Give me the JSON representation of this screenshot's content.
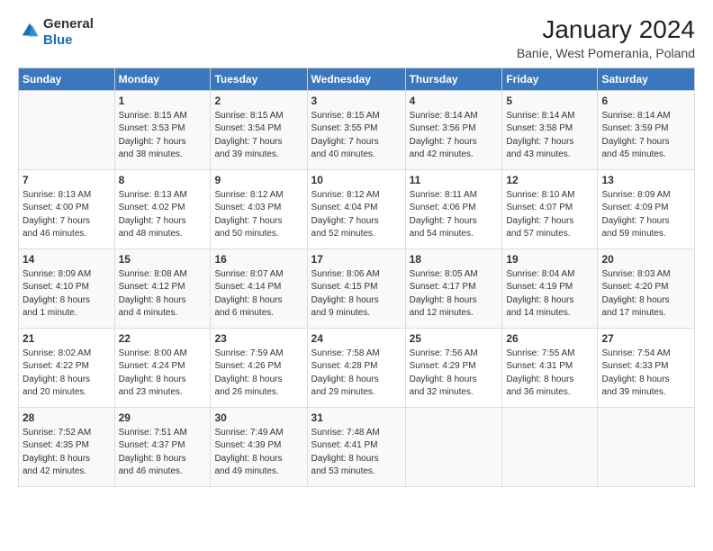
{
  "logo": {
    "general": "General",
    "blue": "Blue"
  },
  "title": "January 2024",
  "subtitle": "Banie, West Pomerania, Poland",
  "days_header": [
    "Sunday",
    "Monday",
    "Tuesday",
    "Wednesday",
    "Thursday",
    "Friday",
    "Saturday"
  ],
  "weeks": [
    [
      {
        "day": "",
        "info": ""
      },
      {
        "day": "1",
        "info": "Sunrise: 8:15 AM\nSunset: 3:53 PM\nDaylight: 7 hours\nand 38 minutes."
      },
      {
        "day": "2",
        "info": "Sunrise: 8:15 AM\nSunset: 3:54 PM\nDaylight: 7 hours\nand 39 minutes."
      },
      {
        "day": "3",
        "info": "Sunrise: 8:15 AM\nSunset: 3:55 PM\nDaylight: 7 hours\nand 40 minutes."
      },
      {
        "day": "4",
        "info": "Sunrise: 8:14 AM\nSunset: 3:56 PM\nDaylight: 7 hours\nand 42 minutes."
      },
      {
        "day": "5",
        "info": "Sunrise: 8:14 AM\nSunset: 3:58 PM\nDaylight: 7 hours\nand 43 minutes."
      },
      {
        "day": "6",
        "info": "Sunrise: 8:14 AM\nSunset: 3:59 PM\nDaylight: 7 hours\nand 45 minutes."
      }
    ],
    [
      {
        "day": "7",
        "info": "Sunrise: 8:13 AM\nSunset: 4:00 PM\nDaylight: 7 hours\nand 46 minutes."
      },
      {
        "day": "8",
        "info": "Sunrise: 8:13 AM\nSunset: 4:02 PM\nDaylight: 7 hours\nand 48 minutes."
      },
      {
        "day": "9",
        "info": "Sunrise: 8:12 AM\nSunset: 4:03 PM\nDaylight: 7 hours\nand 50 minutes."
      },
      {
        "day": "10",
        "info": "Sunrise: 8:12 AM\nSunset: 4:04 PM\nDaylight: 7 hours\nand 52 minutes."
      },
      {
        "day": "11",
        "info": "Sunrise: 8:11 AM\nSunset: 4:06 PM\nDaylight: 7 hours\nand 54 minutes."
      },
      {
        "day": "12",
        "info": "Sunrise: 8:10 AM\nSunset: 4:07 PM\nDaylight: 7 hours\nand 57 minutes."
      },
      {
        "day": "13",
        "info": "Sunrise: 8:09 AM\nSunset: 4:09 PM\nDaylight: 7 hours\nand 59 minutes."
      }
    ],
    [
      {
        "day": "14",
        "info": "Sunrise: 8:09 AM\nSunset: 4:10 PM\nDaylight: 8 hours\nand 1 minute."
      },
      {
        "day": "15",
        "info": "Sunrise: 8:08 AM\nSunset: 4:12 PM\nDaylight: 8 hours\nand 4 minutes."
      },
      {
        "day": "16",
        "info": "Sunrise: 8:07 AM\nSunset: 4:14 PM\nDaylight: 8 hours\nand 6 minutes."
      },
      {
        "day": "17",
        "info": "Sunrise: 8:06 AM\nSunset: 4:15 PM\nDaylight: 8 hours\nand 9 minutes."
      },
      {
        "day": "18",
        "info": "Sunrise: 8:05 AM\nSunset: 4:17 PM\nDaylight: 8 hours\nand 12 minutes."
      },
      {
        "day": "19",
        "info": "Sunrise: 8:04 AM\nSunset: 4:19 PM\nDaylight: 8 hours\nand 14 minutes."
      },
      {
        "day": "20",
        "info": "Sunrise: 8:03 AM\nSunset: 4:20 PM\nDaylight: 8 hours\nand 17 minutes."
      }
    ],
    [
      {
        "day": "21",
        "info": "Sunrise: 8:02 AM\nSunset: 4:22 PM\nDaylight: 8 hours\nand 20 minutes."
      },
      {
        "day": "22",
        "info": "Sunrise: 8:00 AM\nSunset: 4:24 PM\nDaylight: 8 hours\nand 23 minutes."
      },
      {
        "day": "23",
        "info": "Sunrise: 7:59 AM\nSunset: 4:26 PM\nDaylight: 8 hours\nand 26 minutes."
      },
      {
        "day": "24",
        "info": "Sunrise: 7:58 AM\nSunset: 4:28 PM\nDaylight: 8 hours\nand 29 minutes."
      },
      {
        "day": "25",
        "info": "Sunrise: 7:56 AM\nSunset: 4:29 PM\nDaylight: 8 hours\nand 32 minutes."
      },
      {
        "day": "26",
        "info": "Sunrise: 7:55 AM\nSunset: 4:31 PM\nDaylight: 8 hours\nand 36 minutes."
      },
      {
        "day": "27",
        "info": "Sunrise: 7:54 AM\nSunset: 4:33 PM\nDaylight: 8 hours\nand 39 minutes."
      }
    ],
    [
      {
        "day": "28",
        "info": "Sunrise: 7:52 AM\nSunset: 4:35 PM\nDaylight: 8 hours\nand 42 minutes."
      },
      {
        "day": "29",
        "info": "Sunrise: 7:51 AM\nSunset: 4:37 PM\nDaylight: 8 hours\nand 46 minutes."
      },
      {
        "day": "30",
        "info": "Sunrise: 7:49 AM\nSunset: 4:39 PM\nDaylight: 8 hours\nand 49 minutes."
      },
      {
        "day": "31",
        "info": "Sunrise: 7:48 AM\nSunset: 4:41 PM\nDaylight: 8 hours\nand 53 minutes."
      },
      {
        "day": "",
        "info": ""
      },
      {
        "day": "",
        "info": ""
      },
      {
        "day": "",
        "info": ""
      }
    ]
  ]
}
